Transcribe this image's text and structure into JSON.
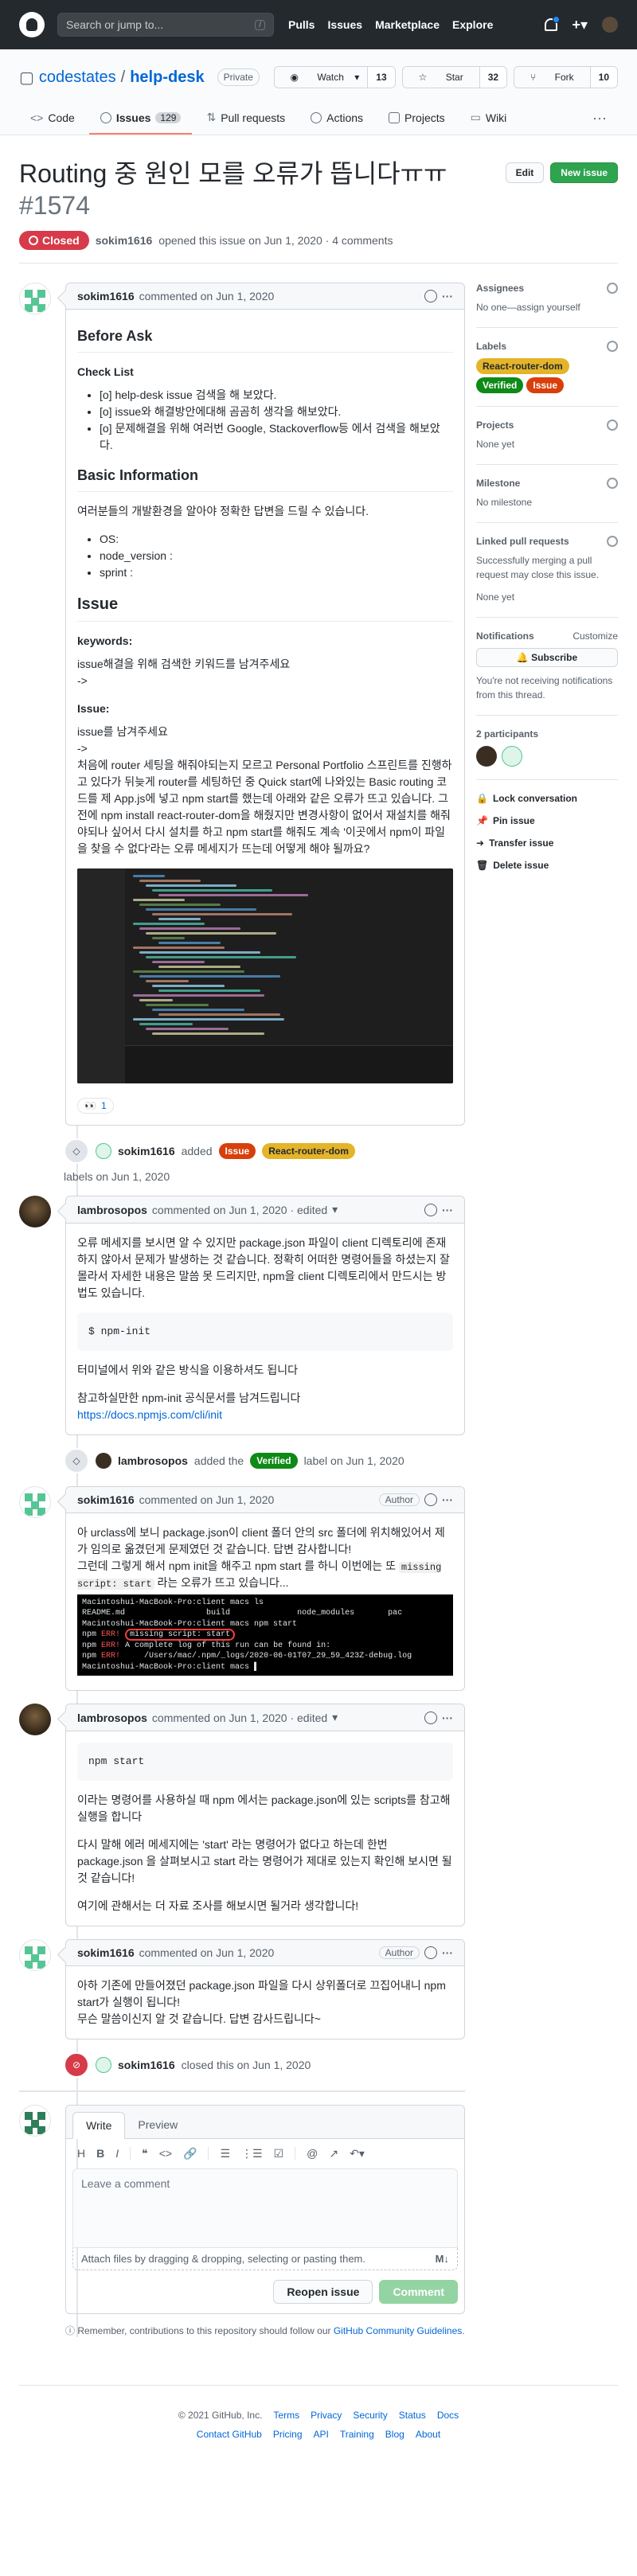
{
  "topbar": {
    "search_placeholder": "Search or jump to...",
    "search_key": "/",
    "nav": [
      "Pulls",
      "Issues",
      "Marketplace",
      "Explore"
    ]
  },
  "repo": {
    "owner": "codestates",
    "sep": "/",
    "name": "help-desk",
    "visibility": "Private",
    "watch": {
      "label": "Watch",
      "count": "13"
    },
    "star": {
      "label": "Star",
      "count": "32"
    },
    "fork": {
      "label": "Fork",
      "count": "10"
    },
    "tabs": [
      {
        "label": "Code"
      },
      {
        "label": "Issues",
        "count": "129"
      },
      {
        "label": "Pull requests"
      },
      {
        "label": "Actions"
      },
      {
        "label": "Projects"
      },
      {
        "label": "Wiki"
      }
    ],
    "more": "···"
  },
  "issue": {
    "title": "Routing 중 원인 모를 오류가 뜹니다ㅠㅠ",
    "number": "#1574",
    "edit": "Edit",
    "new_issue": "New issue",
    "state": "Closed",
    "author": "sokim1616",
    "meta": "opened this issue on Jun 1, 2020 · 4 comments"
  },
  "comments": {
    "c1": {
      "author": "sokim1616",
      "meta": "commented on Jun 1, 2020",
      "h_before": "Before Ask",
      "h_check": "Check List",
      "checks": [
        "[o] help-desk issue 검색을 해 보았다.",
        "[o] issue와 해결방안에대해 곰곰히 생각을 해보았다.",
        "[o] 문제해결을 위해 여러번 Google, Stackoverflow등 에서 검색을 해보았다."
      ],
      "h_basic": "Basic Information",
      "basic_p": "여러분들의 개발환경을 알아야 정확한 답변을 드릴 수 있습니다.",
      "basic_items": [
        "OS:",
        "node_version :",
        "sprint :"
      ],
      "h_issue": "Issue",
      "h_keywords": "keywords:",
      "kw_p1": "issue해결을 위해 검색한 키워드를 남겨주세요",
      "kw_p2": "->",
      "h_issue2": "Issue:",
      "issue_p1": "issue를 남겨주세요",
      "issue_p2": "->",
      "issue_body": "처음에 router 세팅을 해줘야되는지 모르고 Personal Portfolio 스프린트를 진행하고 있다가 뒤늦게 router를 세팅하던 중 Quick start에 나와있는 Basic routing 코드를 제 App.js에 넣고 npm start를 했는데 아래와 같은 오류가 뜨고 있습니다. 그전에 npm install react-router-dom을 해줬지만 변경사항이 없어서 재설치를 해줘야되나 싶어서 다시 설치를 하고 npm start를 해줘도 계속 '이곳에서 npm이 파일을 찾을 수 없다'라는 오류 메세지가 뜨는데 어떻게 해야 될까요?",
      "reaction": {
        "emoji": "👀",
        "count": "1"
      }
    },
    "ev1": {
      "actor": "sokim1616",
      "added": "added",
      "labels": [
        "Issue",
        "React-router-dom"
      ],
      "suffix": "labels on Jun 1, 2020"
    },
    "c2": {
      "author": "lambrosopos",
      "meta": "commented on Jun 1, 2020 · edited",
      "edited_caret": "▾",
      "p1": "오류 메세지를 보시면 알 수 있지만 package.json 파일이 client 디렉토리에 존재하지 않아서 문제가 발생하는 것 같습니다. 정확히 어떠한 명령어들을 하셨는지 잘 몰라서 자세한 내용은 말씀 못 드리지만, npm을 client 디렉토리에서 만드시는 방법도 있습니다.",
      "code": "$ npm-init",
      "p2": "터미널에서 위와 같은 방식을 이용하셔도 됩니다",
      "p3": "참고하실만한 npm-init 공식문서를 남겨드립니다",
      "link": "https://docs.npmjs.com/cli/init"
    },
    "ev2": {
      "actor": "lambrosopos",
      "added": "added the",
      "label": "Verified",
      "suffix": "label on Jun 1, 2020"
    },
    "c3": {
      "author": "sokim1616",
      "meta": "commented on Jun 1, 2020",
      "badge": "Author",
      "p1a": "아 urclass에 보니 package.json이 client 폴더 안의 src 폴더에 위치해있어서 제가 임의로 옮겼던게 문제였던 것 같습니다. 답변 감사합니다!",
      "p1b": "그런데 그렇게 해서 npm init을 해주고 npm start 를 하니 이번에는 또 ",
      "p1code": "missing script: start",
      "p1c": " 라는 오류가 뜨고 있습니다...",
      "term": {
        "l1": "Macintoshui-MacBook-Pro:client macs ls",
        "l2a": "README.md",
        "l2b": "build",
        "l2c": "node_modules",
        "l2d": "pac",
        "l3": "Macintoshui-MacBook-Pro:client macs npm start",
        "l4a": "npm ",
        "l4b": "ERR!",
        "l4c": "missing script: start",
        "l5a": "npm ",
        "l5b": "ERR!",
        "l5c": "A complete log of this run can be found in:",
        "l6a": "npm ",
        "l6b": "ERR!",
        "l6c": "    /Users/mac/.npm/_logs/2020-06-01T07_29_59_423Z-debug.log",
        "l7": "Macintoshui-MacBook-Pro:client macs ▌"
      }
    },
    "c4": {
      "author": "lambrosopos",
      "meta": "commented on Jun 1, 2020 · edited",
      "edited_caret": "▾",
      "code": "npm start",
      "p1": "이라는 명령어를 사용하실 때 npm 에서는 package.json에 있는 scripts를 참고해 실행을 합니다",
      "p2": "다시 말해 에러 메세지에는 'start' 라는 명령어가 없다고 하는데 한번 package.json 을 살펴보시고 start 라는 명령어가 제대로 있는지 확인해 보시면 될 것 같습니다!",
      "p3": "여기에 관해서는 더 자료 조사를 해보시면 될거라 생각합니다!"
    },
    "c5": {
      "author": "sokim1616",
      "meta": "commented on Jun 1, 2020",
      "badge": "Author",
      "p1": "아하 기존에 만들어졌던 package.json 파일을 다시 상위폴더로 끄집어내니 npm start가 실행이 됩니다!",
      "p2": "무슨 말씀이신지 알 것 같습니다. 답변 감사드립니다~"
    },
    "ev3": {
      "actor": "sokim1616",
      "text": "closed this on Jun 1, 2020"
    }
  },
  "newcomment": {
    "write": "Write",
    "preview": "Preview",
    "toolbar": [
      "H",
      "B",
      "I",
      "❝",
      "<>",
      "🔗",
      "☰",
      "⋮☰",
      "☑",
      "@",
      "↗",
      "↶▾"
    ],
    "placeholder": "Leave a comment",
    "attach": "Attach files by dragging & dropping, selecting or pasting them.",
    "md": "M↓",
    "reopen": "Reopen issue",
    "comment": "Comment",
    "tip_pre": "Remember, contributions to this repository should follow our ",
    "tip_link": "GitHub Community Guidelines",
    "tip_post": "."
  },
  "sidebar": {
    "assignees": {
      "title": "Assignees",
      "value": "No one—assign yourself"
    },
    "labels": {
      "title": "Labels",
      "items": [
        "React-router-dom",
        "Verified",
        "Issue"
      ]
    },
    "projects": {
      "title": "Projects",
      "value": "None yet"
    },
    "milestone": {
      "title": "Milestone",
      "value": "No milestone"
    },
    "linked": {
      "title": "Linked pull requests",
      "value": "Successfully merging a pull request may close this issue.",
      "value2": "None yet"
    },
    "notifications": {
      "title": "Notifications",
      "customize": "Customize",
      "button": "Subscribe",
      "note": "You're not receiving notifications from this thread."
    },
    "participants": {
      "title": "2 participants"
    },
    "actions": [
      "Lock conversation",
      "Pin issue",
      "Transfer issue",
      "Delete issue"
    ]
  },
  "footer": {
    "row1": [
      "© 2021 GitHub, Inc.",
      "Terms",
      "Privacy",
      "Security",
      "Status",
      "Docs"
    ],
    "row2": [
      "Contact GitHub",
      "Pricing",
      "API",
      "Training",
      "Blog",
      "About"
    ]
  },
  "colors": {
    "closed": "#d73a49",
    "label_react": "#e4b429",
    "label_verified": "#0e8a16",
    "label_issue": "#d93f0b",
    "accent": "#2ea44f"
  }
}
